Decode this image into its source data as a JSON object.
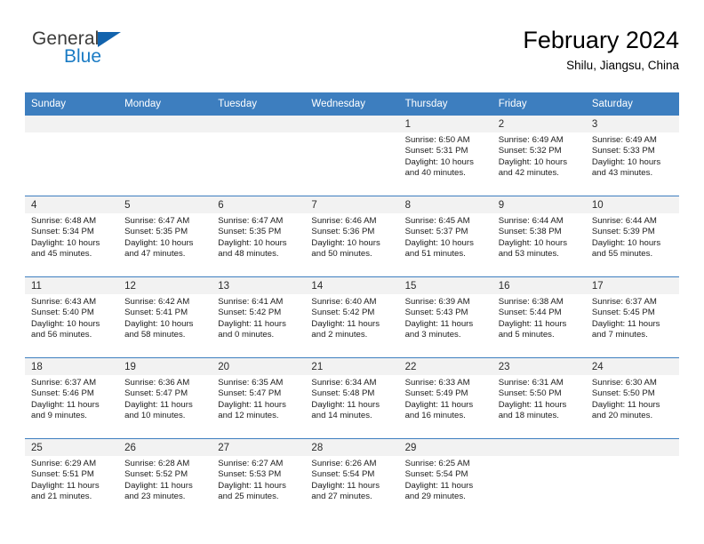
{
  "logo": {
    "word_one": "General",
    "word_two": "Blue",
    "triangle_icon": "blue-triangle-icon",
    "brand_dark": "#3c3c3b",
    "brand_blue": "#1a7bc4"
  },
  "header": {
    "title": "February 2024",
    "location": "Shilu, Jiangsu, China"
  },
  "theme": {
    "header_bg": "#3d7ebf",
    "header_text": "#ffffff",
    "daynum_band_bg": "#f2f2f2",
    "row_divider": "#3d7ebf",
    "cell_bg": "#ffffff",
    "body_text": "#1c1c1c"
  },
  "calendar": {
    "weekday_headers": [
      "Sunday",
      "Monday",
      "Tuesday",
      "Wednesday",
      "Thursday",
      "Friday",
      "Saturday"
    ],
    "labels": {
      "sunrise_prefix": "Sunrise:",
      "sunset_prefix": "Sunset:",
      "daylight_prefix": "Daylight:"
    },
    "weeks": [
      [
        {
          "day": "",
          "empty": true
        },
        {
          "day": "",
          "empty": true
        },
        {
          "day": "",
          "empty": true
        },
        {
          "day": "",
          "empty": true
        },
        {
          "day": "1",
          "sunrise": "Sunrise: 6:50 AM",
          "sunset": "Sunset: 5:31 PM",
          "daylight_line1": "Daylight: 10 hours",
          "daylight_line2": "and 40 minutes."
        },
        {
          "day": "2",
          "sunrise": "Sunrise: 6:49 AM",
          "sunset": "Sunset: 5:32 PM",
          "daylight_line1": "Daylight: 10 hours",
          "daylight_line2": "and 42 minutes."
        },
        {
          "day": "3",
          "sunrise": "Sunrise: 6:49 AM",
          "sunset": "Sunset: 5:33 PM",
          "daylight_line1": "Daylight: 10 hours",
          "daylight_line2": "and 43 minutes."
        }
      ],
      [
        {
          "day": "4",
          "sunrise": "Sunrise: 6:48 AM",
          "sunset": "Sunset: 5:34 PM",
          "daylight_line1": "Daylight: 10 hours",
          "daylight_line2": "and 45 minutes."
        },
        {
          "day": "5",
          "sunrise": "Sunrise: 6:47 AM",
          "sunset": "Sunset: 5:35 PM",
          "daylight_line1": "Daylight: 10 hours",
          "daylight_line2": "and 47 minutes."
        },
        {
          "day": "6",
          "sunrise": "Sunrise: 6:47 AM",
          "sunset": "Sunset: 5:35 PM",
          "daylight_line1": "Daylight: 10 hours",
          "daylight_line2": "and 48 minutes."
        },
        {
          "day": "7",
          "sunrise": "Sunrise: 6:46 AM",
          "sunset": "Sunset: 5:36 PM",
          "daylight_line1": "Daylight: 10 hours",
          "daylight_line2": "and 50 minutes."
        },
        {
          "day": "8",
          "sunrise": "Sunrise: 6:45 AM",
          "sunset": "Sunset: 5:37 PM",
          "daylight_line1": "Daylight: 10 hours",
          "daylight_line2": "and 51 minutes."
        },
        {
          "day": "9",
          "sunrise": "Sunrise: 6:44 AM",
          "sunset": "Sunset: 5:38 PM",
          "daylight_line1": "Daylight: 10 hours",
          "daylight_line2": "and 53 minutes."
        },
        {
          "day": "10",
          "sunrise": "Sunrise: 6:44 AM",
          "sunset": "Sunset: 5:39 PM",
          "daylight_line1": "Daylight: 10 hours",
          "daylight_line2": "and 55 minutes."
        }
      ],
      [
        {
          "day": "11",
          "sunrise": "Sunrise: 6:43 AM",
          "sunset": "Sunset: 5:40 PM",
          "daylight_line1": "Daylight: 10 hours",
          "daylight_line2": "and 56 minutes."
        },
        {
          "day": "12",
          "sunrise": "Sunrise: 6:42 AM",
          "sunset": "Sunset: 5:41 PM",
          "daylight_line1": "Daylight: 10 hours",
          "daylight_line2": "and 58 minutes."
        },
        {
          "day": "13",
          "sunrise": "Sunrise: 6:41 AM",
          "sunset": "Sunset: 5:42 PM",
          "daylight_line1": "Daylight: 11 hours",
          "daylight_line2": "and 0 minutes."
        },
        {
          "day": "14",
          "sunrise": "Sunrise: 6:40 AM",
          "sunset": "Sunset: 5:42 PM",
          "daylight_line1": "Daylight: 11 hours",
          "daylight_line2": "and 2 minutes."
        },
        {
          "day": "15",
          "sunrise": "Sunrise: 6:39 AM",
          "sunset": "Sunset: 5:43 PM",
          "daylight_line1": "Daylight: 11 hours",
          "daylight_line2": "and 3 minutes."
        },
        {
          "day": "16",
          "sunrise": "Sunrise: 6:38 AM",
          "sunset": "Sunset: 5:44 PM",
          "daylight_line1": "Daylight: 11 hours",
          "daylight_line2": "and 5 minutes."
        },
        {
          "day": "17",
          "sunrise": "Sunrise: 6:37 AM",
          "sunset": "Sunset: 5:45 PM",
          "daylight_line1": "Daylight: 11 hours",
          "daylight_line2": "and 7 minutes."
        }
      ],
      [
        {
          "day": "18",
          "sunrise": "Sunrise: 6:37 AM",
          "sunset": "Sunset: 5:46 PM",
          "daylight_line1": "Daylight: 11 hours",
          "daylight_line2": "and 9 minutes."
        },
        {
          "day": "19",
          "sunrise": "Sunrise: 6:36 AM",
          "sunset": "Sunset: 5:47 PM",
          "daylight_line1": "Daylight: 11 hours",
          "daylight_line2": "and 10 minutes."
        },
        {
          "day": "20",
          "sunrise": "Sunrise: 6:35 AM",
          "sunset": "Sunset: 5:47 PM",
          "daylight_line1": "Daylight: 11 hours",
          "daylight_line2": "and 12 minutes."
        },
        {
          "day": "21",
          "sunrise": "Sunrise: 6:34 AM",
          "sunset": "Sunset: 5:48 PM",
          "daylight_line1": "Daylight: 11 hours",
          "daylight_line2": "and 14 minutes."
        },
        {
          "day": "22",
          "sunrise": "Sunrise: 6:33 AM",
          "sunset": "Sunset: 5:49 PM",
          "daylight_line1": "Daylight: 11 hours",
          "daylight_line2": "and 16 minutes."
        },
        {
          "day": "23",
          "sunrise": "Sunrise: 6:31 AM",
          "sunset": "Sunset: 5:50 PM",
          "daylight_line1": "Daylight: 11 hours",
          "daylight_line2": "and 18 minutes."
        },
        {
          "day": "24",
          "sunrise": "Sunrise: 6:30 AM",
          "sunset": "Sunset: 5:50 PM",
          "daylight_line1": "Daylight: 11 hours",
          "daylight_line2": "and 20 minutes."
        }
      ],
      [
        {
          "day": "25",
          "sunrise": "Sunrise: 6:29 AM",
          "sunset": "Sunset: 5:51 PM",
          "daylight_line1": "Daylight: 11 hours",
          "daylight_line2": "and 21 minutes."
        },
        {
          "day": "26",
          "sunrise": "Sunrise: 6:28 AM",
          "sunset": "Sunset: 5:52 PM",
          "daylight_line1": "Daylight: 11 hours",
          "daylight_line2": "and 23 minutes."
        },
        {
          "day": "27",
          "sunrise": "Sunrise: 6:27 AM",
          "sunset": "Sunset: 5:53 PM",
          "daylight_line1": "Daylight: 11 hours",
          "daylight_line2": "and 25 minutes."
        },
        {
          "day": "28",
          "sunrise": "Sunrise: 6:26 AM",
          "sunset": "Sunset: 5:54 PM",
          "daylight_line1": "Daylight: 11 hours",
          "daylight_line2": "and 27 minutes."
        },
        {
          "day": "29",
          "sunrise": "Sunrise: 6:25 AM",
          "sunset": "Sunset: 5:54 PM",
          "daylight_line1": "Daylight: 11 hours",
          "daylight_line2": "and 29 minutes."
        },
        {
          "day": "",
          "empty": true
        },
        {
          "day": "",
          "empty": true
        }
      ]
    ]
  }
}
